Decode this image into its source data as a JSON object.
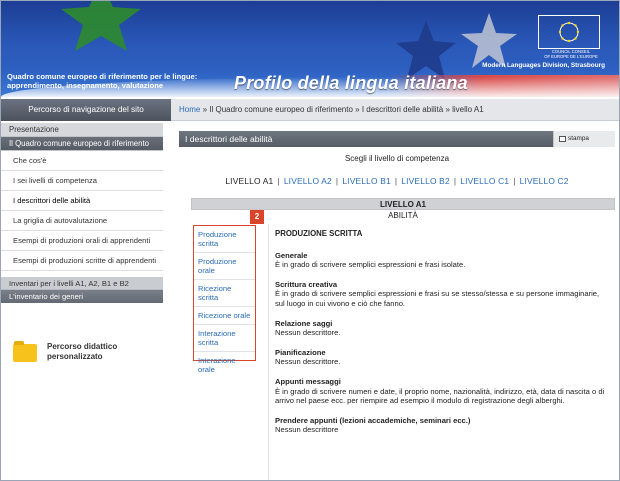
{
  "header": {
    "left_text_line1": "Quadro comune europeo di riferimento per le lingue:",
    "left_text_line2": "apprendimento, insegnamento, valutazione",
    "title": "Profilo della lingua italiana",
    "division": "Modern Languages Division, Strasbourg",
    "coe_text_line1": "COUNCIL   CONSEIL",
    "coe_text_line2": "OF EUROPE  DE L'EUROPE",
    "colors": {
      "blue": "#2a58b8",
      "red": "#d94a4a",
      "star_green": "#2e8b2e"
    }
  },
  "navbar": {
    "left_label": "Percorso di navigazione del sito",
    "breadcrumb": [
      {
        "label": "Home",
        "link": true
      },
      {
        "label": "Il Quadro comune europeo di riferimento",
        "link": false
      },
      {
        "label": "I descrittori delle abilità",
        "link": false
      },
      {
        "label": "livello A1",
        "link": false
      }
    ],
    "separator": "»"
  },
  "sidebar": {
    "presentazione": "Presentazione",
    "active_section": "Il Quadro comune europeo di riferimento",
    "items": [
      "Che cos'è",
      "I sei livelli di competenza",
      "I descrittori delle abilità",
      "La griglia di autovalutazione",
      "Esempi di produzioni orali di apprendenti",
      "Esempi di produzioni scritte di apprendenti"
    ],
    "inventari": "Inventari per i livelli A1, A2, B1 e B2",
    "inventario_generi": "L'inventario dei generi",
    "percorso_line1": "Percorso didattico",
    "percorso_line2": "personalizzato"
  },
  "main": {
    "bar_title": "I descrittori delle abilità",
    "stampa": "stampa",
    "scegli": "Scegli il livello di competenza",
    "levels": [
      "LIVELLO A1",
      "LIVELLO A2",
      "LIVELLO B1",
      "LIVELLO B2",
      "LIVELLO C1",
      "LIVELLO C2"
    ],
    "level_header": "LIVELLO A1",
    "abilita": "ABILITÀ",
    "badge": "2",
    "tabs": [
      "Produzione scritta",
      "Produzione orale",
      "Ricezione scritta",
      "Ricezione orale",
      "Interazione scritta",
      "Interazione orale"
    ],
    "content": {
      "title": "PRODUZIONE SCRITTA",
      "sections": [
        {
          "heading": "Generale",
          "text": "È in grado di scrivere semplici espressioni e frasi isolate."
        },
        {
          "heading": "Scrittura creativa",
          "text": "È in grado di scrivere semplici espressioni e frasi su se stesso/stessa e su persone immaginarie, sul luogo in cui vivono e ciò che fanno."
        },
        {
          "heading": "Relazione saggi",
          "text": "Nessun descrittore."
        },
        {
          "heading": "Pianificazione",
          "text": "Nessun descrittore."
        },
        {
          "heading": "Appunti messaggi",
          "text": "È in grado di scrivere numeri e date, il proprio nome, nazionalità, indirizzo, età, data di nascita o di arrivo nel paese ecc. per riempire ad esempio il modulo di registrazione degli alberghi."
        },
        {
          "heading": "Prendere appunti (lezioni accademiche, seminari ecc.)",
          "text": "Nessun descrittore"
        }
      ]
    }
  }
}
